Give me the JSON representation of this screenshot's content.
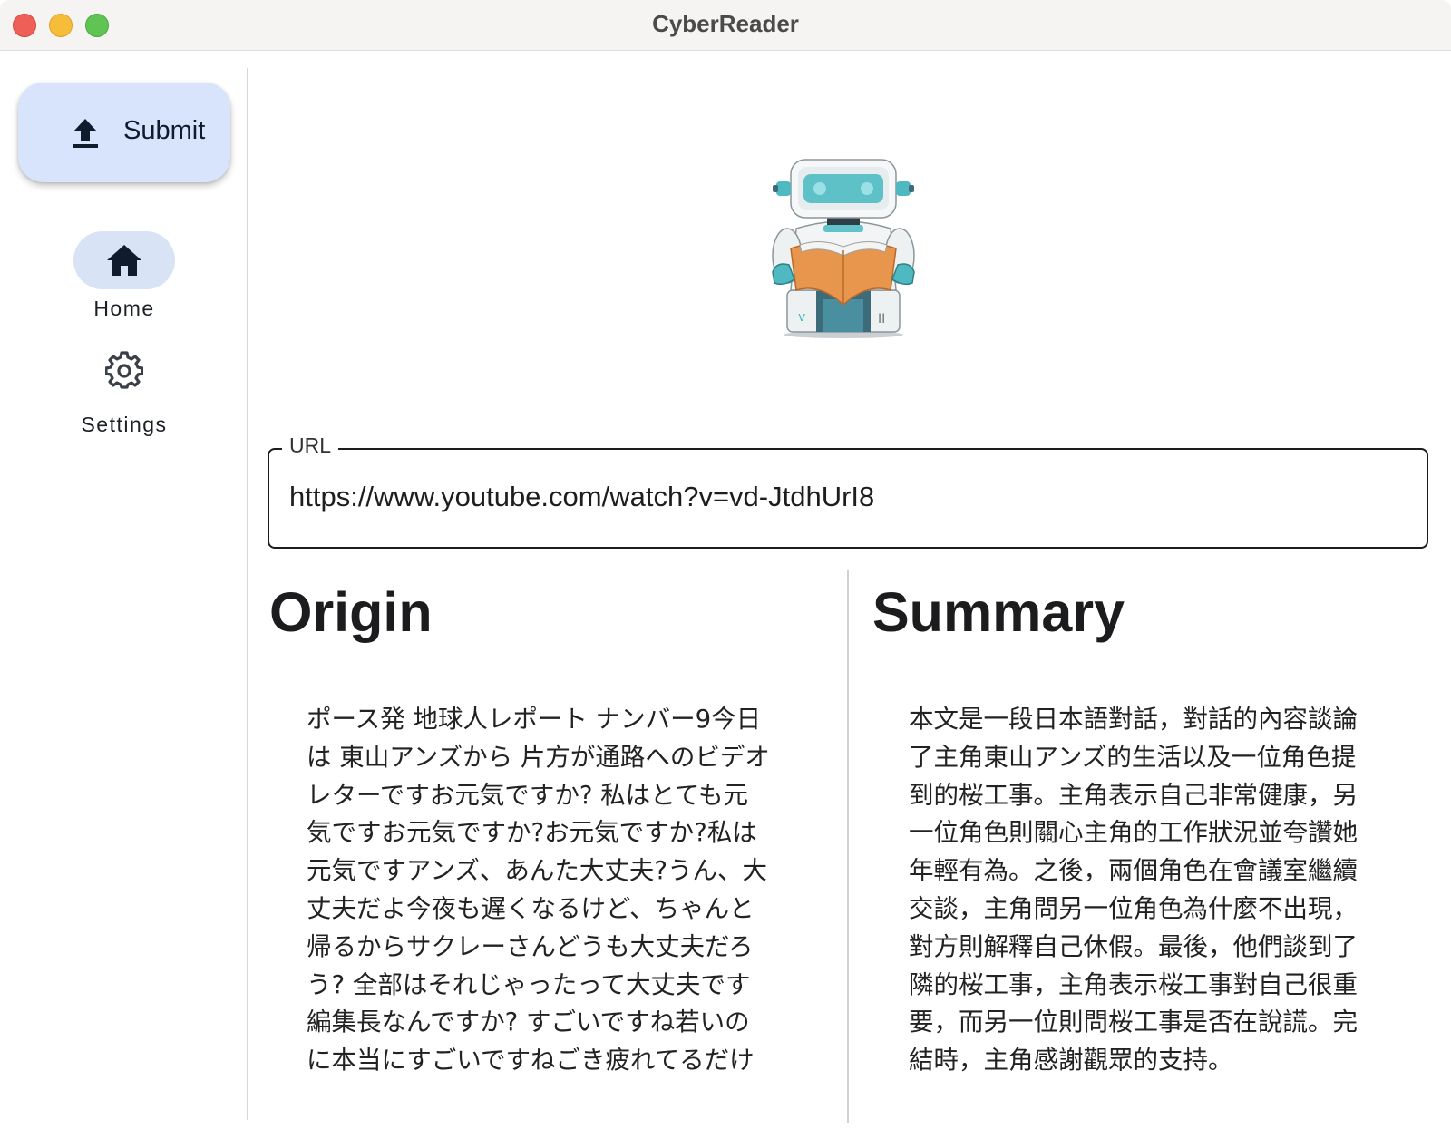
{
  "window": {
    "title": "CyberReader"
  },
  "sidebar": {
    "submit_label": "Submit",
    "nav": [
      {
        "label": "Home",
        "icon": "home-icon",
        "selected": true
      },
      {
        "label": "Settings",
        "icon": "gear-icon",
        "selected": false
      }
    ]
  },
  "main": {
    "url_label": "URL",
    "url_value": "https://www.youtube.com/watch?v=vd-JtdhUrI8",
    "origin": {
      "heading": "Origin",
      "lines": [
        "ポース発 地球人レポート ナンバー9今日",
        "は 東山アンズから 片方が通路へのビデオ",
        "レターですお元気ですか? 私はとても元",
        "気ですお元気ですか?お元気ですか?私は",
        "元気ですアンズ、あんた大丈夫?うん、大",
        "丈夫だよ今夜も遅くなるけど、ちゃんと",
        "帰るからサクレーさんどうも大丈夫だろ",
        "う? 全部はそれじゃったって大丈夫です",
        "編集長なんですか? すごいですね若いの",
        "に本当にすごいですねごき疲れてるだけ"
      ]
    },
    "summary": {
      "heading": "Summary",
      "lines": [
        "本文是一段日本語對話，對話的內容談論",
        "了主角東山アンズ的生活以及一位角色提",
        "到的桜工事。主角表示自己非常健康，另",
        "一位角色則關心主角的工作狀況並夸讚她",
        "年輕有為。之後，兩個角色在會議室繼續",
        "交談，主角問另一位角色為什麼不出現，",
        "對方則解釋自己休假。最後，他們談到了",
        "隣的桜工事，主角表示桜工事對自己很重",
        "要，而另一位則問桜工事是否在說謊。完",
        "結時，主角感謝觀眾的支持。"
      ]
    }
  },
  "colors": {
    "submit_bg": "#d8e4fb",
    "nav_selected_bg": "#d9e3f6",
    "close": "#ee5f57",
    "minimize": "#f6bd3b",
    "maximize": "#5fc454"
  }
}
